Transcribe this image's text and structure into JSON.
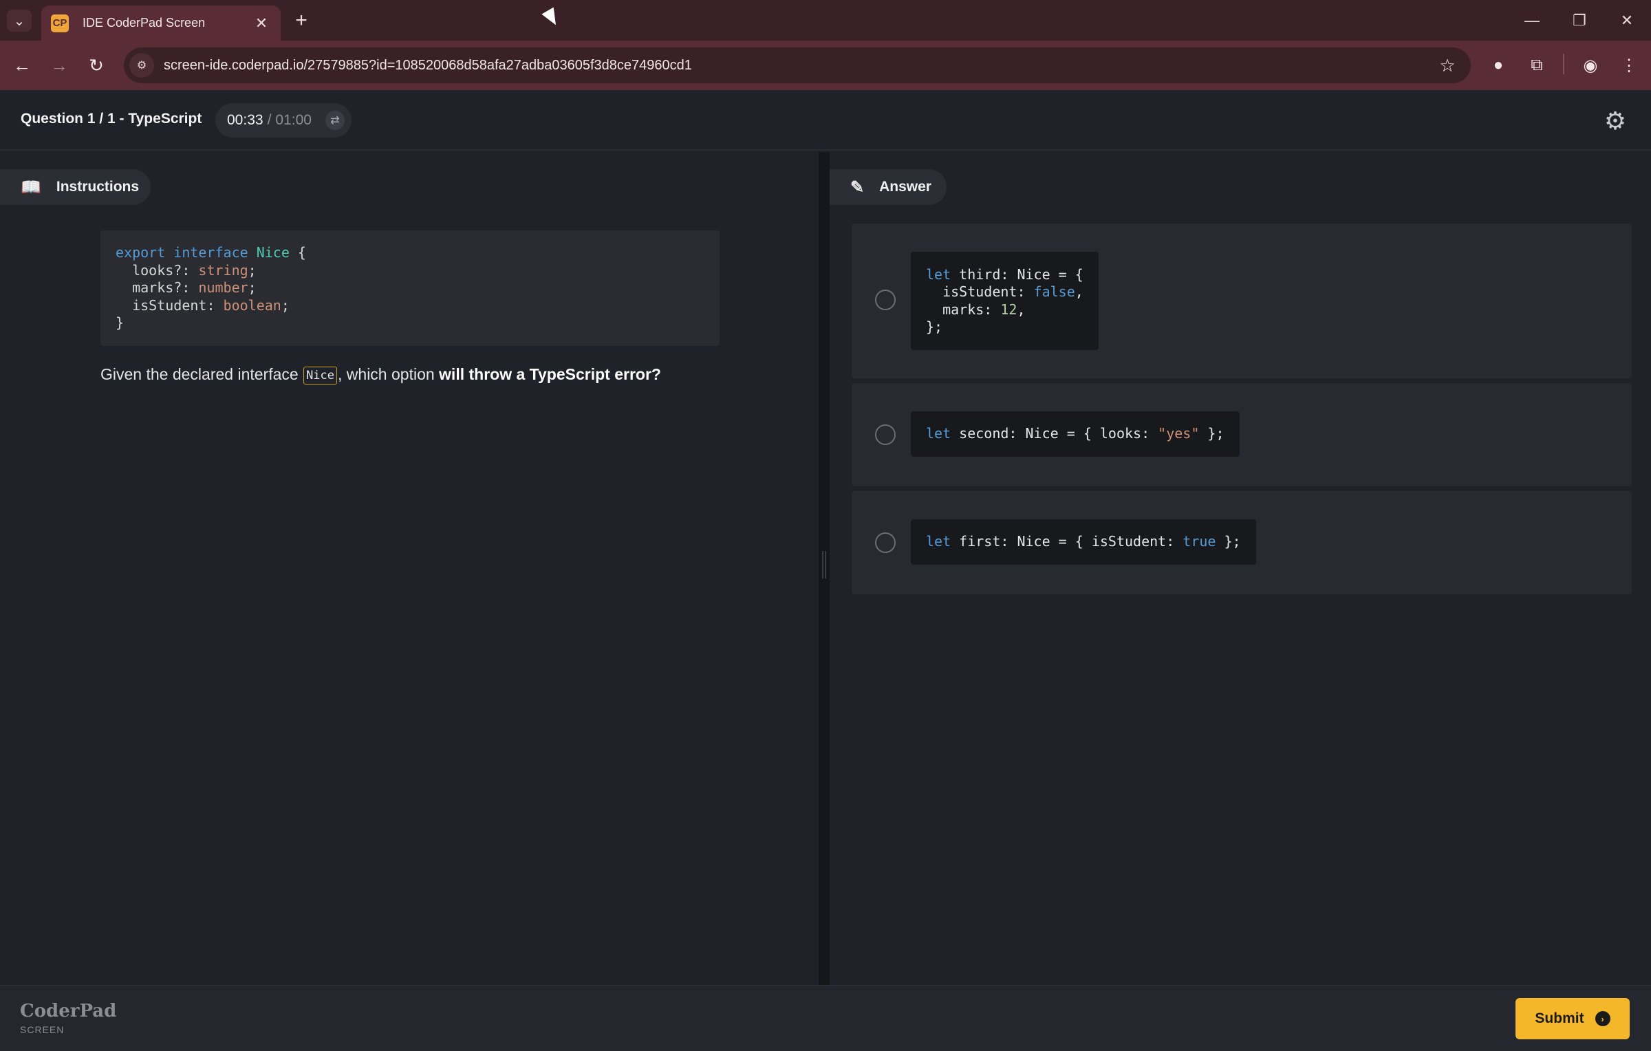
{
  "browser": {
    "tab_title": "IDE CoderPad Screen",
    "tab_favicon": "CP",
    "url": "screen-ide.coderpad.io/27579885?id=108520068d58afa27adba03605f3d8ce74960cd1",
    "icons": {
      "tab_menu": "chevron-down-icon",
      "close": "close-icon",
      "new_tab": "plus-icon",
      "back": "back-arrow-icon",
      "forward": "forward-arrow-icon",
      "reload": "reload-icon",
      "site_info": "tune-icon",
      "bookmark": "star-icon",
      "extension_1": "extension-icon",
      "extensions": "puzzle-icon",
      "profile": "profile-icon",
      "menu": "kebab-menu-icon"
    }
  },
  "header": {
    "question_title": "Question 1 / 1 - TypeScript",
    "timer": {
      "elapsed": "00:33",
      "separator": "/",
      "total": "01:00"
    },
    "icons": {
      "timer_toggle": "swap-icon",
      "settings": "gear-icon"
    }
  },
  "instructions": {
    "tab_label": "Instructions",
    "icon": "book-icon",
    "code_lines": [
      "export interface Nice {",
      "  looks?: string;",
      "  marks?: number;",
      "  isStudent: boolean;",
      "}"
    ],
    "question_prefix": "Given the declared interface ",
    "question_code": "Nice",
    "question_middle": ", which option ",
    "question_bold": "will throw a TypeScript error?"
  },
  "answer": {
    "tab_label": "Answer",
    "icon": "pencil-icon",
    "options": [
      {
        "code_lines": [
          "let third: Nice = {",
          "  isStudent: false,",
          "  marks: 12,",
          "};"
        ],
        "selected": false
      },
      {
        "code_lines": [
          "let second: Nice = { looks: \"yes\" };"
        ],
        "selected": false
      },
      {
        "code_lines": [
          "let first: Nice = { isStudent: true };"
        ],
        "selected": false
      }
    ]
  },
  "footer": {
    "brand": "CoderPad",
    "brand_sub": "SCREEN",
    "submit_label": "Submit",
    "submit_icon": "arrow-circle-right-icon"
  },
  "colors": {
    "browser_frame": "#3a2127",
    "browser_toolbar": "#5a2d36",
    "app_bg": "#1f2228",
    "submit_accent": "#f5b72a",
    "keyword": "#569cd6",
    "type_name": "#4ec9b0",
    "string": "#ce9178"
  }
}
